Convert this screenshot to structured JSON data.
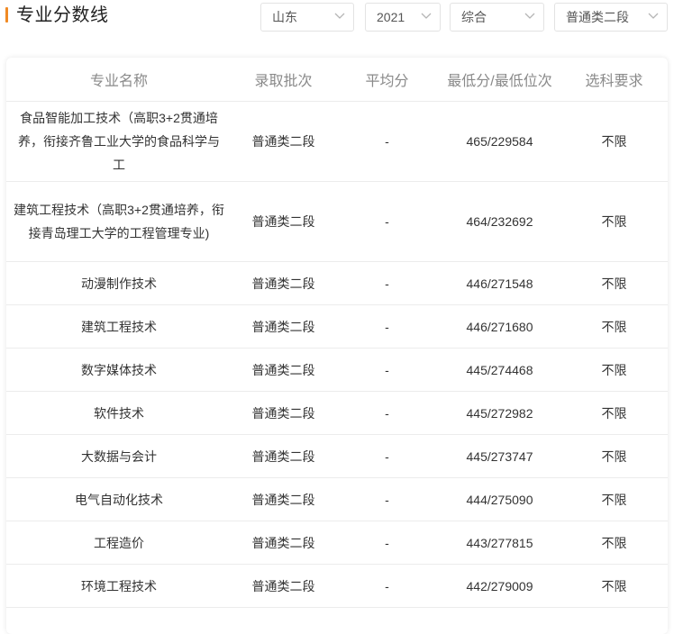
{
  "page": {
    "title": "专业分数线"
  },
  "filters": {
    "province": "山东",
    "year": "2021",
    "category": "综合",
    "batch": "普通类二段"
  },
  "table": {
    "headers": [
      "专业名称",
      "录取批次",
      "平均分",
      "最低分/最低位次",
      "选科要求"
    ],
    "rows": [
      {
        "major": "食品智能加工技术（高职3+2贯通培养，衔接齐鲁工业大学的食品科学与工",
        "batch": "普通类二段",
        "avg": "-",
        "min": "465/229584",
        "req": "不限"
      },
      {
        "major": "建筑工程技术（高职3+2贯通培养，衔接青岛理工大学的工程管理专业)",
        "batch": "普通类二段",
        "avg": "-",
        "min": "464/232692",
        "req": "不限"
      },
      {
        "major": "动漫制作技术",
        "batch": "普通类二段",
        "avg": "-",
        "min": "446/271548",
        "req": "不限"
      },
      {
        "major": "建筑工程技术",
        "batch": "普通类二段",
        "avg": "-",
        "min": "446/271680",
        "req": "不限"
      },
      {
        "major": "数字媒体技术",
        "batch": "普通类二段",
        "avg": "-",
        "min": "445/274468",
        "req": "不限"
      },
      {
        "major": "软件技术",
        "batch": "普通类二段",
        "avg": "-",
        "min": "445/272982",
        "req": "不限"
      },
      {
        "major": "大数据与会计",
        "batch": "普通类二段",
        "avg": "-",
        "min": "445/273747",
        "req": "不限"
      },
      {
        "major": "电气自动化技术",
        "batch": "普通类二段",
        "avg": "-",
        "min": "444/275090",
        "req": "不限"
      },
      {
        "major": "工程造价",
        "batch": "普通类二段",
        "avg": "-",
        "min": "443/277815",
        "req": "不限"
      },
      {
        "major": "环境工程技术",
        "batch": "普通类二段",
        "avg": "-",
        "min": "442/279009",
        "req": "不限"
      }
    ]
  },
  "colors": {
    "accent": "#f08a24",
    "header_text": "#8a8a8a",
    "body_text": "#333333",
    "border": "#ececec"
  },
  "icons": {
    "dropdown": "chevron-down-icon"
  }
}
